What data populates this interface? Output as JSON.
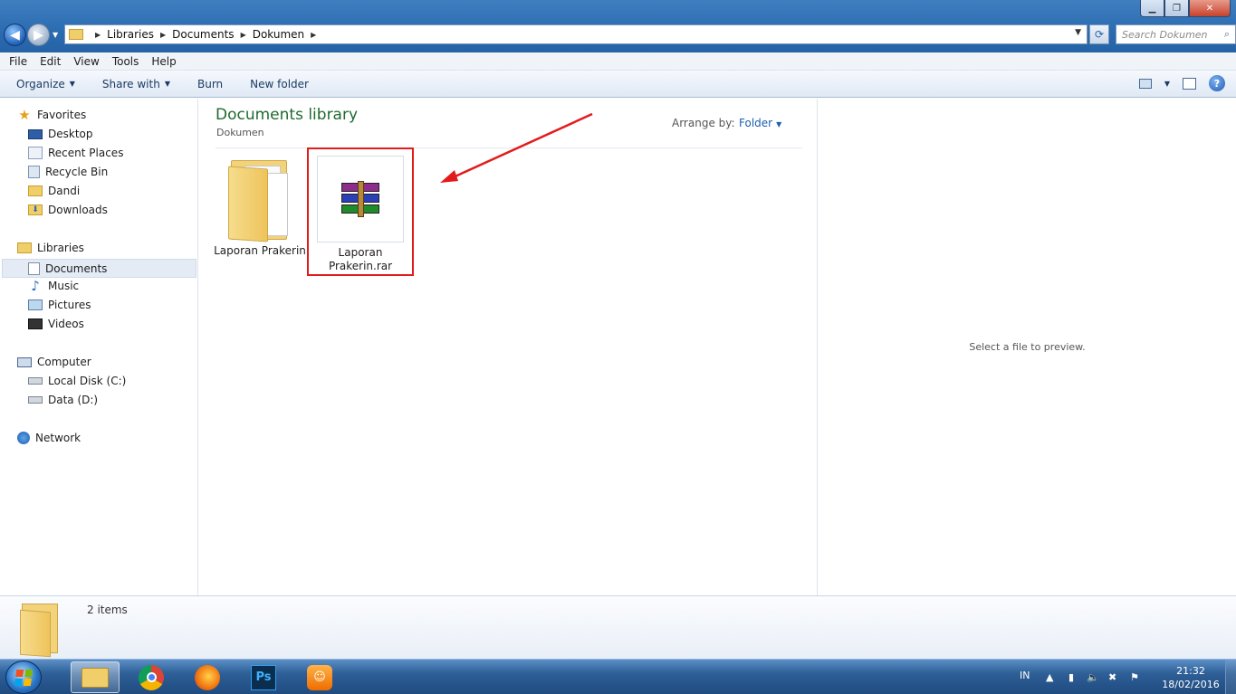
{
  "address": {
    "breadcrumbs": [
      "Libraries",
      "Documents",
      "Dokumen"
    ],
    "search_placeholder": "Search Dokumen"
  },
  "menu": [
    "File",
    "Edit",
    "View",
    "Tools",
    "Help"
  ],
  "toolbar": {
    "organize": "Organize",
    "share_with": "Share with",
    "burn": "Burn",
    "new_folder": "New folder"
  },
  "nav": {
    "favorites": "Favorites",
    "favorites_items": [
      "Desktop",
      "Recent Places",
      "Recycle Bin",
      "Dandi",
      "Downloads"
    ],
    "libraries": "Libraries",
    "libraries_items": [
      "Documents",
      "Music",
      "Pictures",
      "Videos"
    ],
    "computer": "Computer",
    "computer_items": [
      "Local Disk (C:)",
      "Data (D:)"
    ],
    "network": "Network"
  },
  "content": {
    "title": "Documents library",
    "subtitle": "Dokumen",
    "arrange_label": "Arrange by:",
    "arrange_value": "Folder",
    "items": [
      "Laporan Prakerin",
      "Laporan Prakerin.rar"
    ]
  },
  "preview": {
    "message": "Select a file to preview."
  },
  "details": {
    "count": "2 items"
  },
  "taskbar": {
    "language": "IN",
    "time": "21:32",
    "date": "18/02/2016",
    "photoshop_label": "Ps"
  },
  "colors": {
    "library_title": "#1e6b2e",
    "link_blue": "#1b5fb3",
    "annotation_red": "#e31b1b"
  }
}
